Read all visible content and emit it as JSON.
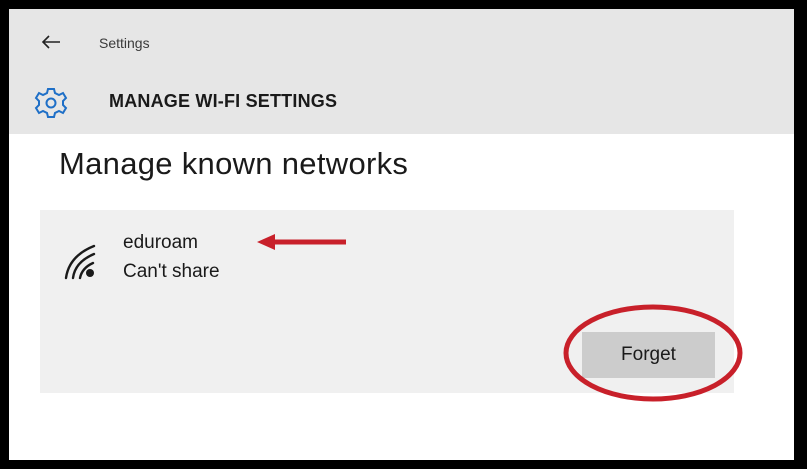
{
  "header": {
    "breadcrumb": "Settings",
    "title": "MANAGE WI-FI SETTINGS"
  },
  "main": {
    "heading": "Manage known networks",
    "networks": [
      {
        "name": "eduroam",
        "status": "Can't share",
        "icon": "wifi-signal-icon",
        "action_label": "Forget"
      }
    ]
  },
  "icons": {
    "back": "back-arrow-icon",
    "settings": "gear-icon"
  },
  "colors": {
    "header_bg": "#e6e6e6",
    "card_bg": "#f0f0f0",
    "button_bg": "#cccccc",
    "accent": "#1e6fc7",
    "annotation": "#c8202a"
  }
}
